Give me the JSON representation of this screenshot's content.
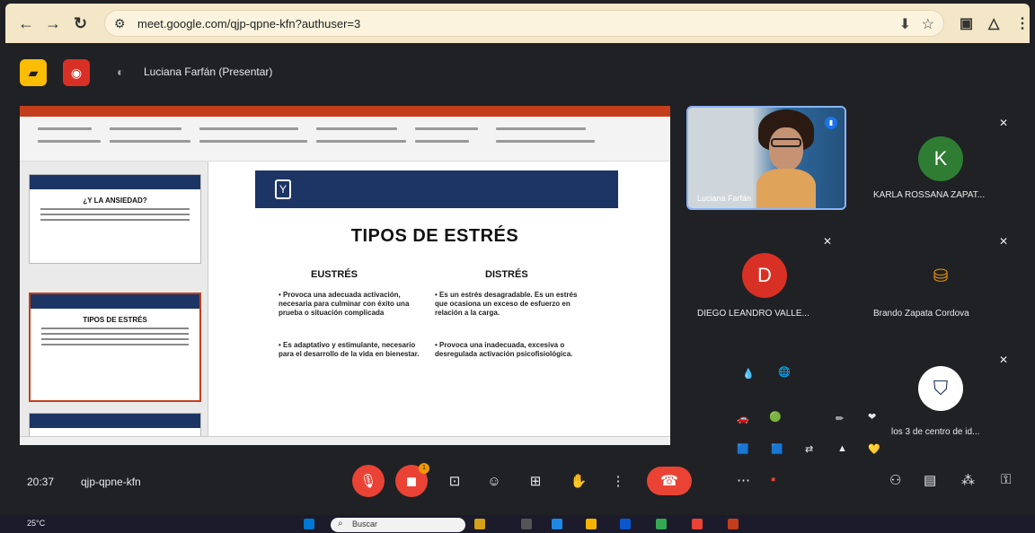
{
  "browser": {
    "url": "meet.google.com/qjp-qpne-kfn?authuser=3"
  },
  "meet": {
    "presenter_label": "Luciana Farfán (Presentar)",
    "meeting_time": "20:37",
    "meeting_code": "qjp-qpne-kfn",
    "reaction_badge_count": "1"
  },
  "slide": {
    "title": "TIPOS DE ESTRÉS",
    "left_heading": "EUSTRÉS",
    "right_heading": "DISTRÉS",
    "left_bullets": [
      "Provoca una adecuada activación, necesaria para culminar con éxito una prueba o situación complicada",
      "Es adaptativo y estimulante, necesario para el desarrollo de la vida en bienestar."
    ],
    "right_bullets": [
      "Es un estrés desagradable. Es un estrés que ocasiona un exceso de esfuerzo en relación a la carga.",
      "Provoca una inadecuada, excesiva o desregulada activación psicofisiológica."
    ]
  },
  "thumbnails": [
    {
      "title": "¿Y LA ANSIEDAD?"
    },
    {
      "title": "TIPOS DE ESTRÉS"
    }
  ],
  "participants": [
    {
      "name": "Luciana Farfán",
      "initial": "",
      "color": "#8ab4f8"
    },
    {
      "name": "KARLA ROSSANA ZAPAT...",
      "initial": "K",
      "color": "#2e7d32"
    },
    {
      "name": "DIEGO LEANDRO VALLE...",
      "initial": "D",
      "color": "#d93025"
    },
    {
      "name": "Brando Zapata Cordova",
      "initial": "",
      "color": "#f29900"
    },
    {
      "name": "los 3 de centro de id...",
      "initial": "",
      "color": "#1c3565"
    }
  ],
  "taskbar": {
    "search_placeholder": "Buscar",
    "weather": "25°C"
  }
}
